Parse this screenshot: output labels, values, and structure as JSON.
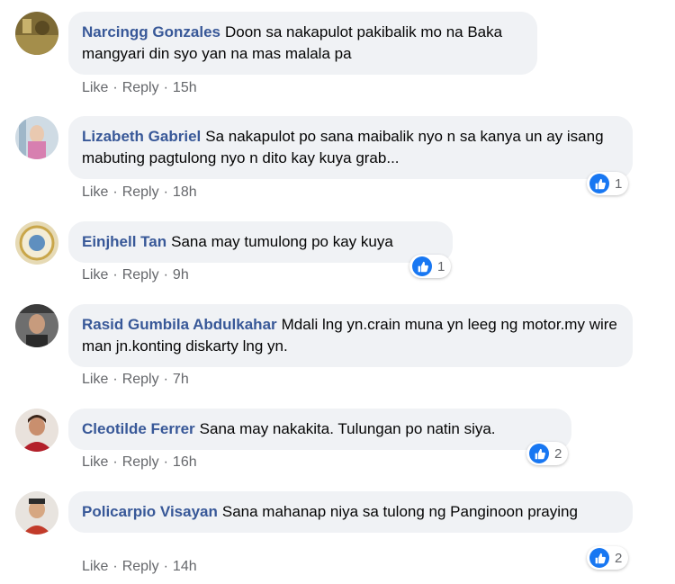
{
  "comments": [
    {
      "name": "Narcingg Gonzales",
      "text": "Doon sa nakapulot pakibalik mo na Baka mangyari din syo yan na mas malala pa",
      "like": "Like",
      "reply": "Reply",
      "time": "15h",
      "avatar_color": "#6b5b2a"
    },
    {
      "name": "Lizabeth Gabriel",
      "text": "Sa nakapulot po sana maibalik nyo n sa kanya un ay isang mabuting pagtulong nyo n dito kay kuya grab...",
      "like": "Like",
      "reply": "Reply",
      "time": "18h",
      "reactions": "1",
      "avatar_color": "#c6d6e3"
    },
    {
      "name": "Einjhell Tan",
      "text": "Sana may tumulong po kay kuya",
      "like": "Like",
      "reply": "Reply",
      "time": "9h",
      "reactions": "1",
      "avatar_color": "#d9c99a"
    },
    {
      "name": "Rasid Gumbila Abdulkahar",
      "text": "Mdali lng yn.crain muna yn leeg ng motor.my wire man jn.konting diskarty lng yn.",
      "like": "Like",
      "reply": "Reply",
      "time": "7h",
      "avatar_color": "#3a3a3a"
    },
    {
      "name": "Cleotilde Ferrer",
      "text": "Sana may nakakita. Tulungan po natin siya.",
      "like": "Like",
      "reply": "Reply",
      "time": "16h",
      "reactions": "2",
      "avatar_color": "#a02020"
    },
    {
      "name": "Policarpio Visayan",
      "text": "Sana mahanap niya sa tulong ng Panginoon praying",
      "like": "Like",
      "reply": "Reply",
      "time": "14h",
      "reactions": "2",
      "avatar_color": "#d9b89a"
    }
  ],
  "dot": "·",
  "colors": {
    "name": "#385898",
    "bubble": "#f0f2f5",
    "meta": "#65676b",
    "like_blue": "#1877f2"
  },
  "icons": {
    "reaction": "thumbs-up-icon"
  }
}
